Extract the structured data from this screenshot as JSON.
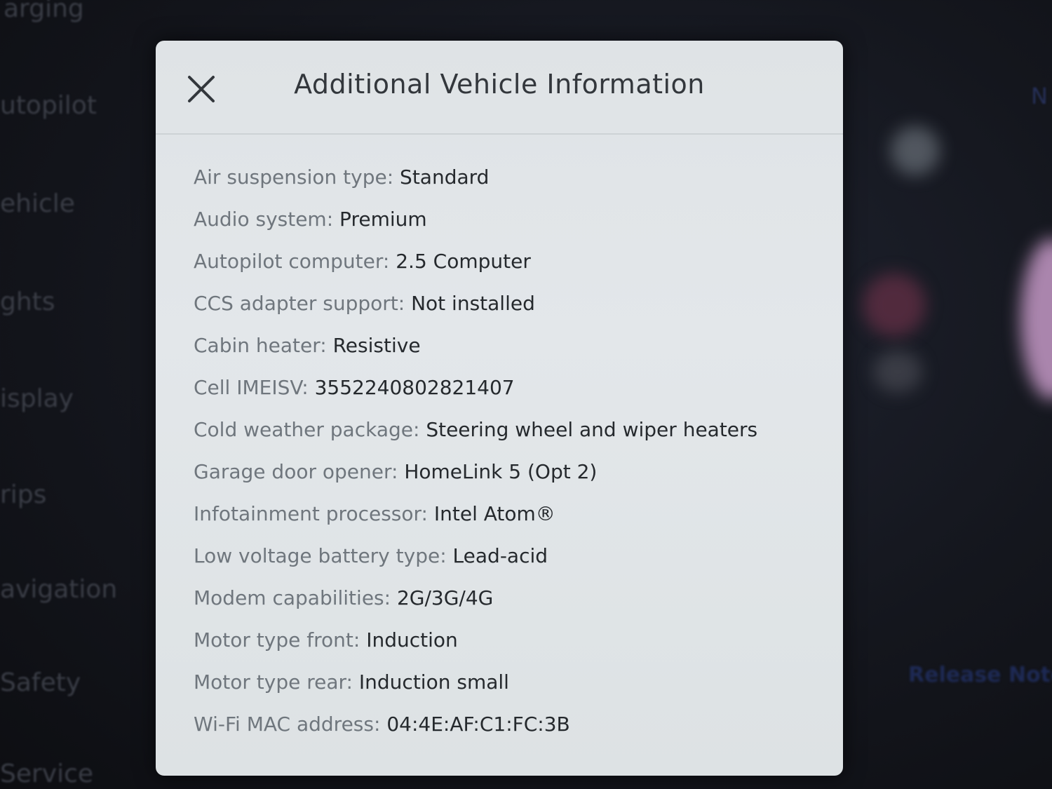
{
  "background_menu": {
    "items": [
      {
        "label": "arging"
      },
      {
        "label": "utopilot"
      },
      {
        "label": "ehicle"
      },
      {
        "label": "ghts"
      },
      {
        "label": "isplay"
      },
      {
        "label": "rips"
      },
      {
        "label": "avigation"
      },
      {
        "label": "Safety"
      },
      {
        "label": "Service"
      }
    ],
    "right_label": "Release Note",
    "corner_label": "N"
  },
  "modal": {
    "title": "Additional Vehicle Information",
    "close_icon": "close-icon",
    "rows": [
      {
        "label": "Air suspension type: ",
        "value": "Standard"
      },
      {
        "label": "Audio system: ",
        "value": "Premium"
      },
      {
        "label": "Autopilot computer: ",
        "value": "2.5 Computer"
      },
      {
        "label": "CCS adapter support: ",
        "value": "Not installed"
      },
      {
        "label": "Cabin heater: ",
        "value": "Resistive"
      },
      {
        "label": "Cell IMEISV: ",
        "value": "3552240802821407"
      },
      {
        "label": "Cold weather package: ",
        "value": "Steering wheel and wiper heaters"
      },
      {
        "label": "Garage door opener: ",
        "value": "HomeLink 5 (Opt 2)"
      },
      {
        "label": "Infotainment processor: ",
        "value": "Intel Atom®"
      },
      {
        "label": "Low voltage battery type: ",
        "value": "Lead-acid"
      },
      {
        "label": "Modem capabilities: ",
        "value": "2G/3G/4G"
      },
      {
        "label": "Motor type front: ",
        "value": "Induction"
      },
      {
        "label": "Motor type rear: ",
        "value": "Induction small"
      },
      {
        "label": "Wi-Fi MAC address: ",
        "value": "04:4E:AF:C1:FC:3B"
      }
    ]
  }
}
